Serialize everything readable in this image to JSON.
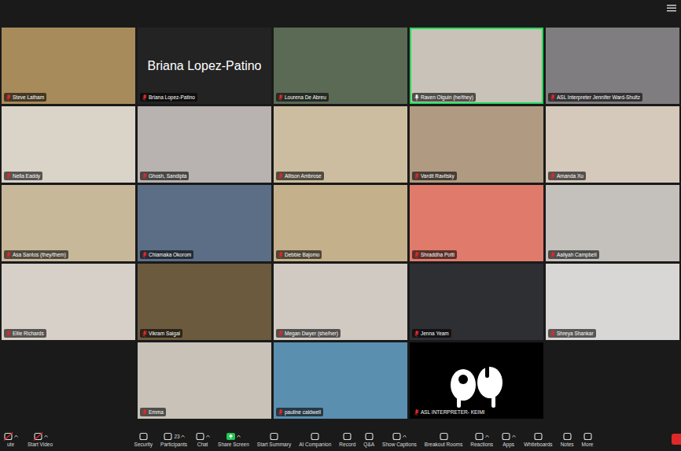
{
  "tiles": [
    {
      "name": "Steve Latham",
      "kind": "video",
      "muted": true,
      "speaking": false,
      "color": "#a88b5a"
    },
    {
      "name": "Briana Lopez-Patino",
      "kind": "name-only",
      "muted": true,
      "speaking": false,
      "color": "#232323"
    },
    {
      "name": "Lourena De Abreu",
      "kind": "video",
      "muted": true,
      "speaking": false,
      "color": "#5a6a55"
    },
    {
      "name": "Raven Olguin (he/they)",
      "kind": "video",
      "muted": false,
      "speaking": true,
      "color": "#c9c2b8"
    },
    {
      "name": "ASL Interpreter Jennifer Ward-Shultz",
      "kind": "video",
      "muted": true,
      "speaking": false,
      "color": "#7f7d7f"
    },
    {
      "name": "Nella Eaddy",
      "kind": "video",
      "muted": true,
      "speaking": false,
      "color": "#d9d3c8"
    },
    {
      "name": "Ghosh, Sandipta",
      "kind": "video",
      "muted": true,
      "speaking": false,
      "color": "#b8b3b0"
    },
    {
      "name": "Allison Ambrose",
      "kind": "video",
      "muted": true,
      "speaking": false,
      "color": "#cdbda0"
    },
    {
      "name": "Vardit Ravitsky",
      "kind": "video",
      "muted": true,
      "speaking": false,
      "color": "#b09b82"
    },
    {
      "name": "Amanda Xu",
      "kind": "video",
      "muted": true,
      "speaking": false,
      "color": "#d5c9bb"
    },
    {
      "name": "Asa Santos (they/them)",
      "kind": "video",
      "muted": true,
      "speaking": false,
      "color": "#c8b89a"
    },
    {
      "name": "Chiamaka Okorom",
      "kind": "video",
      "muted": true,
      "speaking": false,
      "color": "#5b6e86"
    },
    {
      "name": "Debbie Bajomo",
      "kind": "video",
      "muted": true,
      "speaking": false,
      "color": "#c4b08a"
    },
    {
      "name": "Shraddha Potti",
      "kind": "video",
      "muted": true,
      "speaking": false,
      "color": "#e07a6a"
    },
    {
      "name": "Aaliyah Campbell",
      "kind": "video",
      "muted": true,
      "speaking": false,
      "color": "#c4c0bc"
    },
    {
      "name": "Ellie Richards",
      "kind": "video",
      "muted": true,
      "speaking": false,
      "color": "#d6d0c8"
    },
    {
      "name": "Vikram Saigal",
      "kind": "video",
      "muted": true,
      "speaking": false,
      "color": "#6b5a3e"
    },
    {
      "name": "Megan Dwyer (she/her)",
      "kind": "video",
      "muted": true,
      "speaking": false,
      "color": "#d0cac2"
    },
    {
      "name": "Jenna Yeam",
      "kind": "video",
      "muted": true,
      "speaking": false,
      "color": "#2d2f33"
    },
    {
      "name": "Shreya Shankar",
      "kind": "video",
      "muted": true,
      "speaking": false,
      "color": "#d9d7d5"
    },
    {
      "name": "Emma",
      "kind": "video",
      "muted": true,
      "speaking": false,
      "color": "#c8c2b8"
    },
    {
      "name": "pauline caldwell",
      "kind": "video",
      "muted": true,
      "speaking": false,
      "color": "#5a8fb0"
    },
    {
      "name": "ASL INTERPRETER- KEIMI",
      "kind": "avatar",
      "muted": true,
      "speaking": false,
      "color": "#000000"
    }
  ],
  "toolbar": {
    "left": [
      {
        "label": "ute",
        "muted": true,
        "caret": true,
        "highlight": false
      },
      {
        "label": "Start Video",
        "muted": true,
        "caret": true,
        "highlight": false
      }
    ],
    "center": [
      {
        "label": "Security",
        "muted": false,
        "caret": false,
        "highlight": false
      },
      {
        "label": "Participants",
        "muted": false,
        "caret": true,
        "highlight": false,
        "badge": "23"
      },
      {
        "label": "Chat",
        "muted": false,
        "caret": true,
        "highlight": false
      },
      {
        "label": "Share Screen",
        "muted": false,
        "caret": true,
        "highlight": true
      },
      {
        "label": "Start Summary",
        "muted": false,
        "caret": false,
        "highlight": false
      },
      {
        "label": "AI Companion",
        "muted": false,
        "caret": false,
        "highlight": false
      },
      {
        "label": "Record",
        "muted": false,
        "caret": false,
        "highlight": false
      },
      {
        "label": "Q&A",
        "muted": false,
        "caret": false,
        "highlight": false
      },
      {
        "label": "Show Captions",
        "muted": false,
        "caret": true,
        "highlight": false
      },
      {
        "label": "Breakout Rooms",
        "muted": false,
        "caret": false,
        "highlight": false
      },
      {
        "label": "Reactions",
        "muted": false,
        "caret": true,
        "highlight": false
      },
      {
        "label": "Apps",
        "muted": false,
        "caret": true,
        "highlight": false
      },
      {
        "label": "Whiteboards",
        "muted": false,
        "caret": false,
        "highlight": false
      },
      {
        "label": "Notes",
        "muted": false,
        "caret": false,
        "highlight": false
      },
      {
        "label": "More",
        "muted": false,
        "caret": false,
        "highlight": false
      }
    ]
  }
}
